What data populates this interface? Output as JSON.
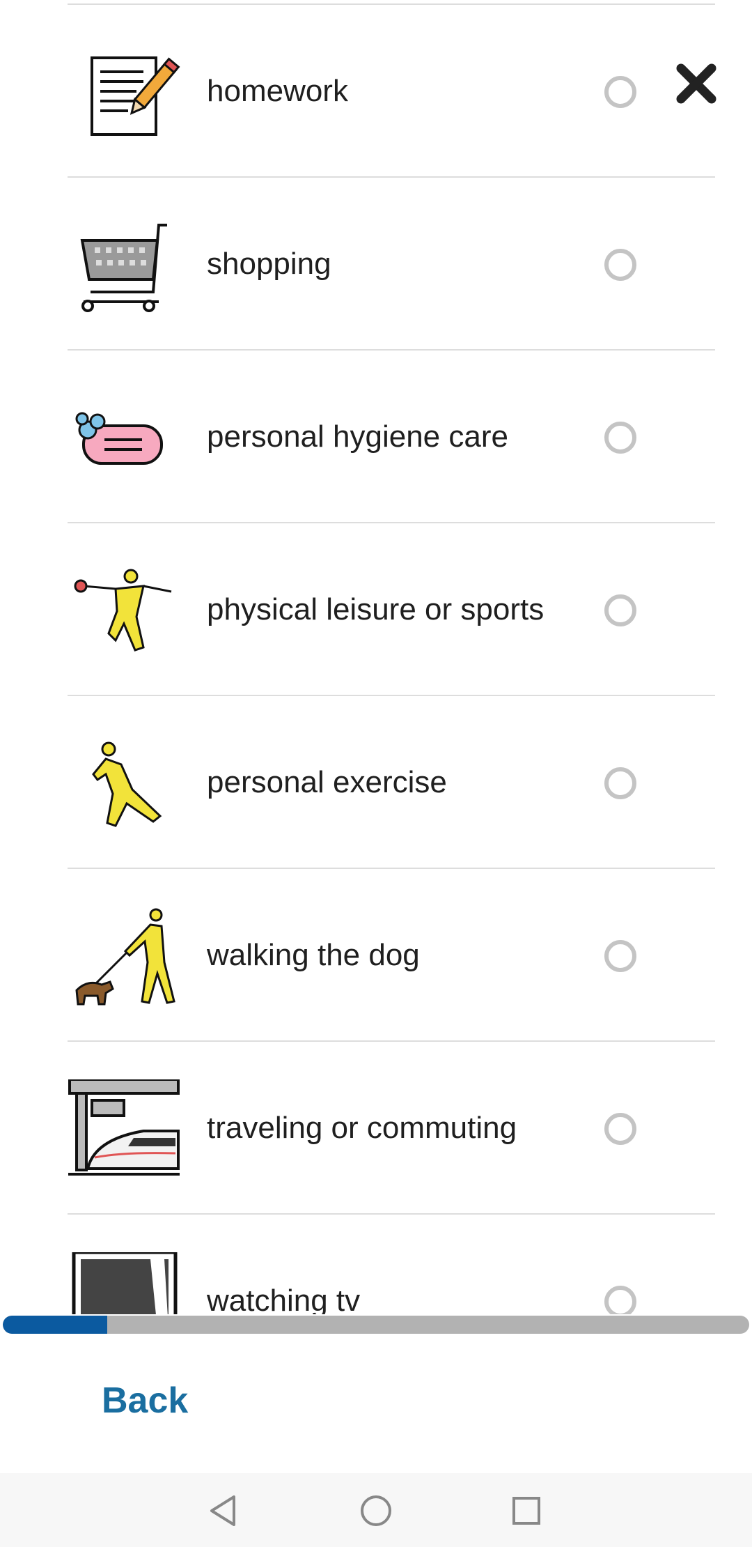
{
  "activities": [
    {
      "label": "homework",
      "icon": "homework-pencil-paper-icon",
      "selected": false
    },
    {
      "label": "shopping",
      "icon": "shopping-cart-icon",
      "selected": false
    },
    {
      "label": "personal hygiene care",
      "icon": "soap-icon",
      "selected": false
    },
    {
      "label": "physical leisure or sports",
      "icon": "sports-player-icon",
      "selected": false
    },
    {
      "label": "personal exercise",
      "icon": "walking-person-icon",
      "selected": false
    },
    {
      "label": "walking the dog",
      "icon": "dog-walking-icon",
      "selected": false
    },
    {
      "label": "traveling or commuting",
      "icon": "train-station-icon",
      "selected": false
    },
    {
      "label": "watching tv",
      "icon": "television-icon",
      "selected": false
    }
  ],
  "close_button": {
    "icon": "close-icon"
  },
  "progress": {
    "fraction": 0.14
  },
  "footer": {
    "back_label": "Back"
  },
  "navigation_bar": {
    "back_icon": "nav-back-triangle-icon",
    "home_icon": "nav-home-circle-icon",
    "recents_icon": "nav-recents-square-icon"
  },
  "colors": {
    "accent": "#0b5aa0",
    "back_link": "#1a6ea0",
    "radio_border": "#c4c4c4",
    "divider": "#dddddd"
  }
}
